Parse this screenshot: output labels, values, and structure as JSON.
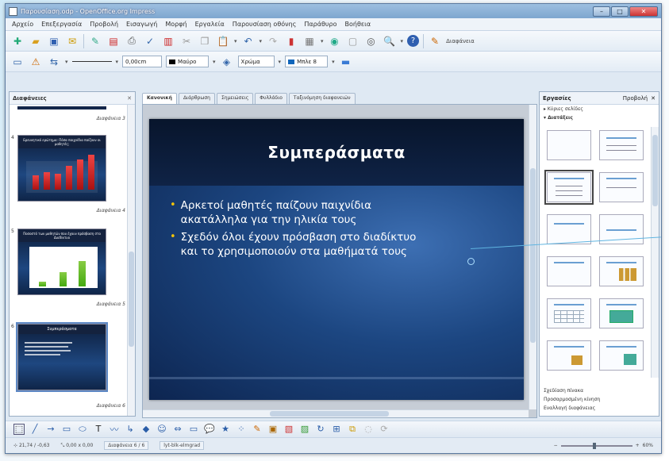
{
  "window": {
    "title": "Παρουσίαση.odp - OpenOffice.org Impress"
  },
  "menu": [
    "Αρχείο",
    "Επεξεργασία",
    "Προβολή",
    "Εισαγωγή",
    "Μορφή",
    "Εργαλεία",
    "Παρουσίαση οθόνης",
    "Παράθυρο",
    "Βοήθεια"
  ],
  "toolbar2": {
    "width": "0,00cm",
    "color": "Μαύρο",
    "area": "Χρώμα",
    "areacolor": "Μπλε 8"
  },
  "toolbar1": {
    "action": "Διαφάνεια"
  },
  "slides_pane": {
    "title": "Διαφάνειες",
    "items": [
      {
        "num": "",
        "label": "Διαφάνεια 3"
      },
      {
        "num": "4",
        "label": "Διαφάνεια 4",
        "thumb_title": "Ερευνητικό ερώτημα: Πόσα παιχνίδια παίζουν οι μαθητές;"
      },
      {
        "num": "5",
        "label": "Διαφάνεια 5",
        "thumb_title": "Ποσοστό των μαθητών που έχουν πρόσβαση στο Διαδίκτυο"
      },
      {
        "num": "6",
        "label": "Διαφάνεια 6",
        "thumb_title": "Συμπεράσματα"
      }
    ]
  },
  "view_tabs": [
    "Κανονική",
    "Διάρθρωση",
    "Σημειώσεις",
    "Φυλλάδιο",
    "Ταξινόμηση διαφανειών"
  ],
  "slide": {
    "title": "Συμπεράσματα",
    "bullets": [
      "Αρκετοί μαθητές παίζουν παιχνίδια ακατάλληλα για την ηλικία τους",
      "Σχεδόν όλοι έχουν πρόσβαση στο διαδίκτυο και το χρησιμοποιούν στα μαθήματά τους"
    ]
  },
  "tasks_pane": {
    "title": "Εργασίες",
    "view": "Προβολή",
    "sections": [
      "Κύριες σελίδες",
      "Διατάξεις"
    ],
    "foot": [
      "Σχεδίαση πίνακα",
      "Προσαρμοσμένη κίνηση",
      "Εναλλαγή διαφάνειας"
    ]
  },
  "statusbar": {
    "position": "21,74 / -0,63",
    "size": "0,00 x 0,00",
    "slide": "Διαφάνεια 6 / 6",
    "layout": "lyt-blk-elmgrad",
    "zoom": "60%"
  },
  "colors": {
    "slide_bg": "#1c4681",
    "bullet": "#f2c40a"
  }
}
